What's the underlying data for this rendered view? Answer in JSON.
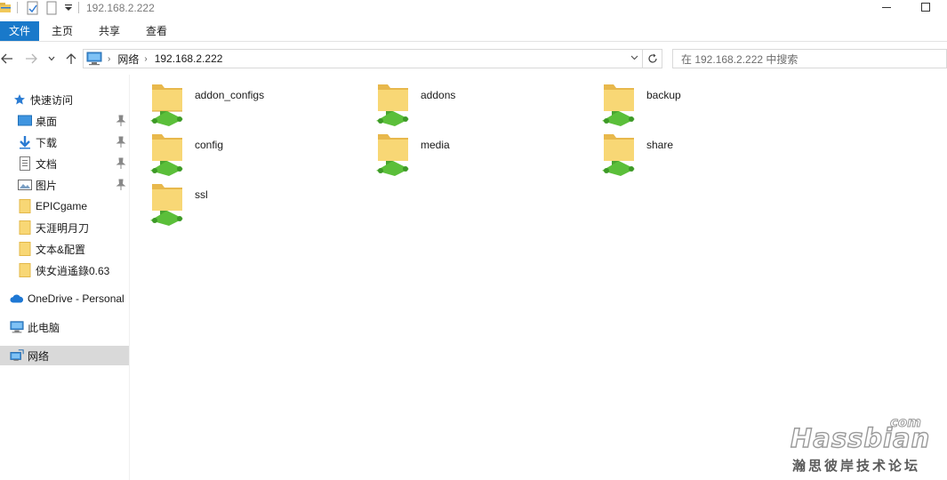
{
  "window": {
    "title": "192.168.2.222"
  },
  "ribbon": {
    "tabs": [
      "文件",
      "主页",
      "共享",
      "查看"
    ]
  },
  "address": {
    "crumbs": [
      "网络",
      "192.168.2.222"
    ]
  },
  "search": {
    "placeholder": "在 192.168.2.222 中搜索"
  },
  "sidebar": {
    "quick_access": "快速访问",
    "pinned": [
      "桌面",
      "下载",
      "文档",
      "图片"
    ],
    "recent": [
      "EPICgame",
      "天涯明月刀",
      "文本&配置",
      "侠女逍遙錄0.63"
    ],
    "onedrive": "OneDrive - Personal",
    "this_pc": "此电脑",
    "network": "网络"
  },
  "folders": [
    "addon_configs",
    "addons",
    "backup",
    "config",
    "media",
    "share",
    "ssl"
  ],
  "watermark": {
    "brand": "Hassbian",
    "com": "com",
    "cn": "瀚思彼岸技术论坛"
  },
  "colors": {
    "accent": "#1979ca",
    "folder": "#f8d775",
    "share_pipe": "#5bbf3a",
    "selected": "#d9d9d9"
  }
}
